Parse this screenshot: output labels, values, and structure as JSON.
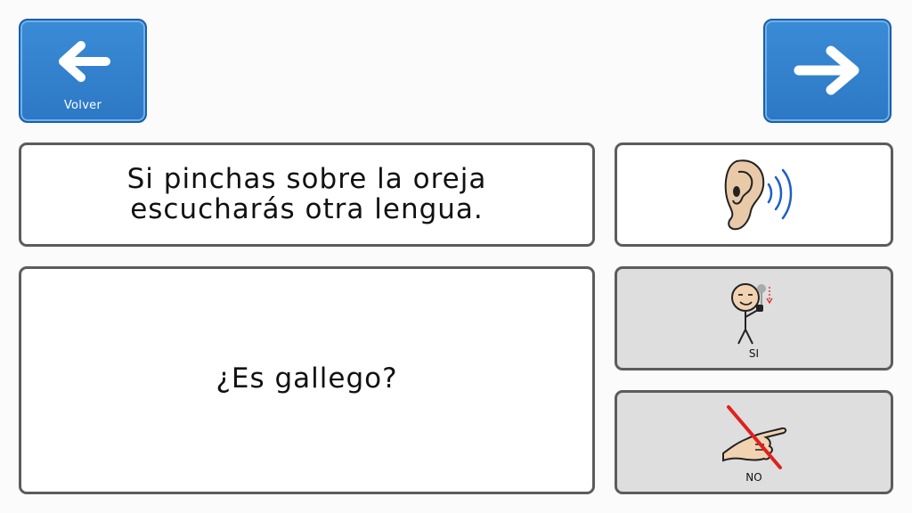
{
  "nav": {
    "back_label": "Volver",
    "back_icon": "arrow-left-icon",
    "next_label": "",
    "next_icon": "arrow-right-icon"
  },
  "message": {
    "line1": "Si pinchas sobre la oreja",
    "line2": "escucharás otra lengua."
  },
  "question": {
    "text": "¿Es gallego?"
  },
  "ear_button": {
    "icon": "ear-sound-icon"
  },
  "options": {
    "yes_label": "SI",
    "yes_icon": "yes-gesture-icon",
    "no_label": "NO",
    "no_icon": "no-gesture-icon"
  },
  "colors": {
    "nav_blue": "#2d78c4",
    "border_dark": "#5c5c5c",
    "option_grey": "#dedede",
    "no_cross_red": "#e0201f",
    "sound_wave_blue": "#1f5fc2"
  }
}
